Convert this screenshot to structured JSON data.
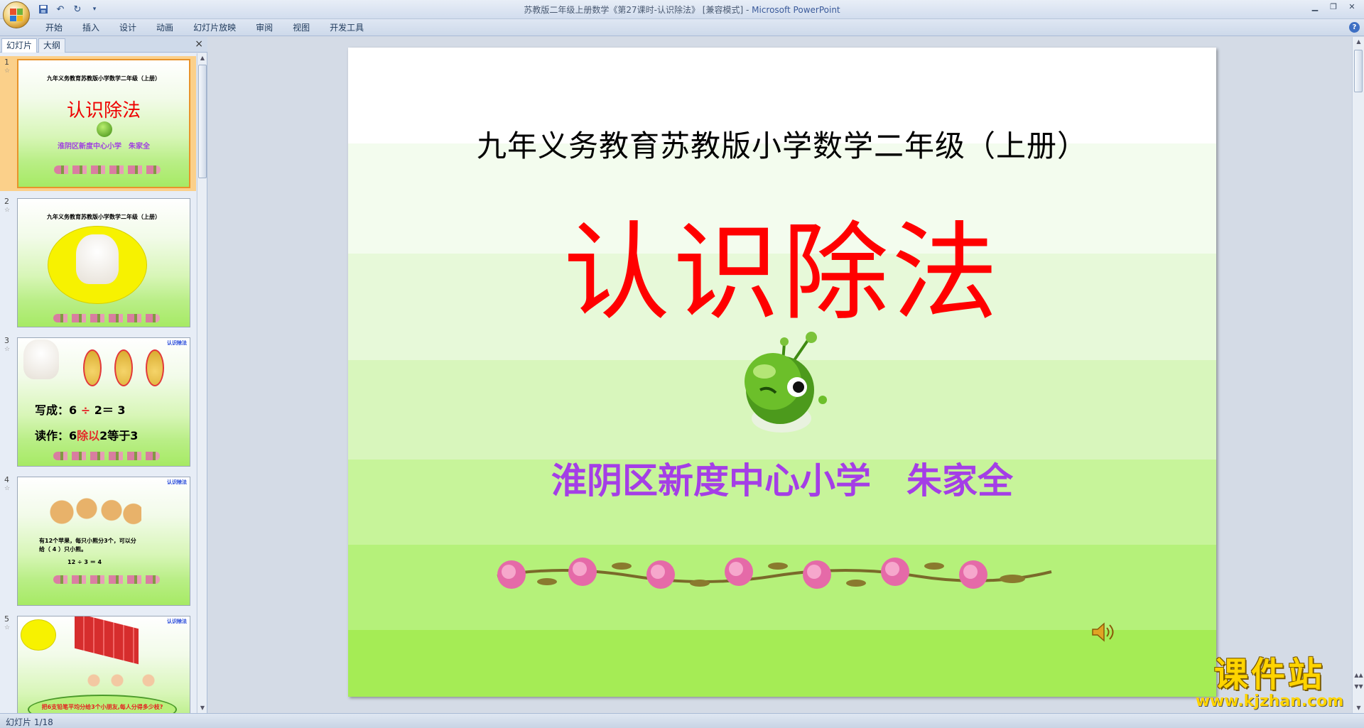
{
  "app": {
    "window_title": "苏教版二年级上册数学《第27课时-认识除法》 [兼容模式] - ",
    "app_name": "Microsoft PowerPoint"
  },
  "ribbon": {
    "tabs": [
      "开始",
      "插入",
      "设计",
      "动画",
      "幻灯片放映",
      "审阅",
      "视图",
      "开发工具"
    ]
  },
  "left_pane": {
    "tab_slides": "幻灯片",
    "tab_outline": "大纲",
    "close": "×"
  },
  "slides": [
    {
      "num": "1",
      "header": "九年义务教育苏教版小学数学二年级（上册）",
      "title": "认识除法",
      "subtitle": "淮阴区新度中心小学　朱家全"
    },
    {
      "num": "2",
      "header": "九年义务教育苏教版小学数学二年级（上册）"
    },
    {
      "num": "3",
      "tag": "认识除法",
      "line1_a": "写成：6 ",
      "line1_op": "÷",
      "line1_b": " 2＝ 3",
      "line2_a": "读作：6",
      "line2_op": "除以",
      "line2_b": "2等于3"
    },
    {
      "num": "4",
      "tag": "认识除法",
      "text1": "有12个苹果，每只小熊分3个，可以分",
      "text2": "给（ 4 ）只小熊。",
      "eq": "12 ÷ 3 ＝ 4"
    },
    {
      "num": "5",
      "tag": "认识除法",
      "bubble": "把6支铅笔平均分给3个小朋友,每人分得多少枝?"
    }
  ],
  "main_slide": {
    "header": "九年义务教育苏教版小学数学二年级（上册）",
    "title": "认识除法",
    "subtitle": "淮阴区新度中心小学　朱家全"
  },
  "status": {
    "slide_counter": "幻灯片 1/18"
  },
  "watermark": {
    "big": "课件站",
    "url": "www.kjzhan.com"
  },
  "colors": {
    "title_red": "#ff0000",
    "subtitle_purple": "#a43ee6",
    "selected_slide": "#fbd08a"
  }
}
